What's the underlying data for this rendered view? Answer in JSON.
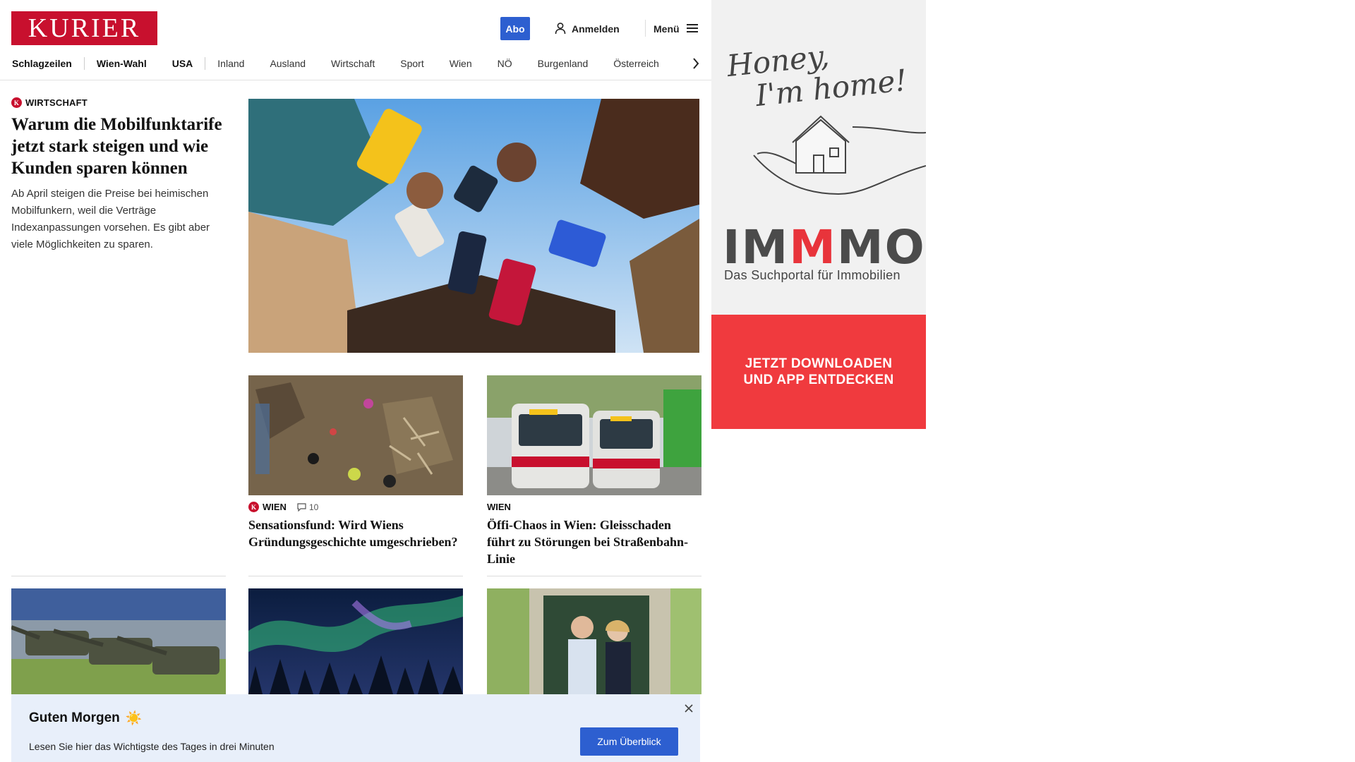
{
  "header": {
    "logo": "KURIER",
    "abo_label": "Abo",
    "login_label": "Anmelden",
    "menu_label": "Menü",
    "nav": [
      "Schlagzeilen",
      "Wien-Wahl",
      "USA",
      "Inland",
      "Ausland",
      "Wirtschaft",
      "Sport",
      "Wien",
      "NÖ",
      "Burgenland",
      "Österreich"
    ]
  },
  "lead": {
    "badge": "K",
    "category": "Wirtschaft",
    "title": "Warum die Mobilfunktarife jetzt stark steigen und wie Kunden sparen können",
    "teaser": "Ab April steigen die Preise bei heimischen Mobilfunkern, weil die Verträge Indexanpassungen vorsehen. Es gibt aber viele Möglichkeiten zu sparen."
  },
  "cards": [
    {
      "badge": "K",
      "category": "Wien",
      "comments": "10",
      "title": "Sensationsfund: Wird Wiens Gründungsgeschichte umgeschrieben?"
    },
    {
      "category": "Wien",
      "title": "Öffi-Chaos in Wien: Gleisschaden führt zu Störungen bei Straßenbahn-Linie"
    }
  ],
  "ad": {
    "script_line1": "Honey,",
    "script_line2": "I'm home!",
    "brand_a": "IM",
    "brand_m": "M",
    "brand_b": "MO",
    "subtitle": "Das Suchportal für Immobilien",
    "cta_line1": "JETZT DOWNLOADEN",
    "cta_line2": "UND APP ENTDECKEN",
    "colors": {
      "cta": "#f03a3e",
      "brand_accent": "#e8343b"
    }
  },
  "banner": {
    "title": "Guten Morgen",
    "emoji": "☀️",
    "text": "Lesen Sie hier das Wichtigste des Tages in drei Minuten",
    "button": "Zum Überblick"
  },
  "colors": {
    "brand_red": "#c8102e",
    "accent_blue": "#2d5fd0",
    "banner_bg": "#e8effa"
  }
}
